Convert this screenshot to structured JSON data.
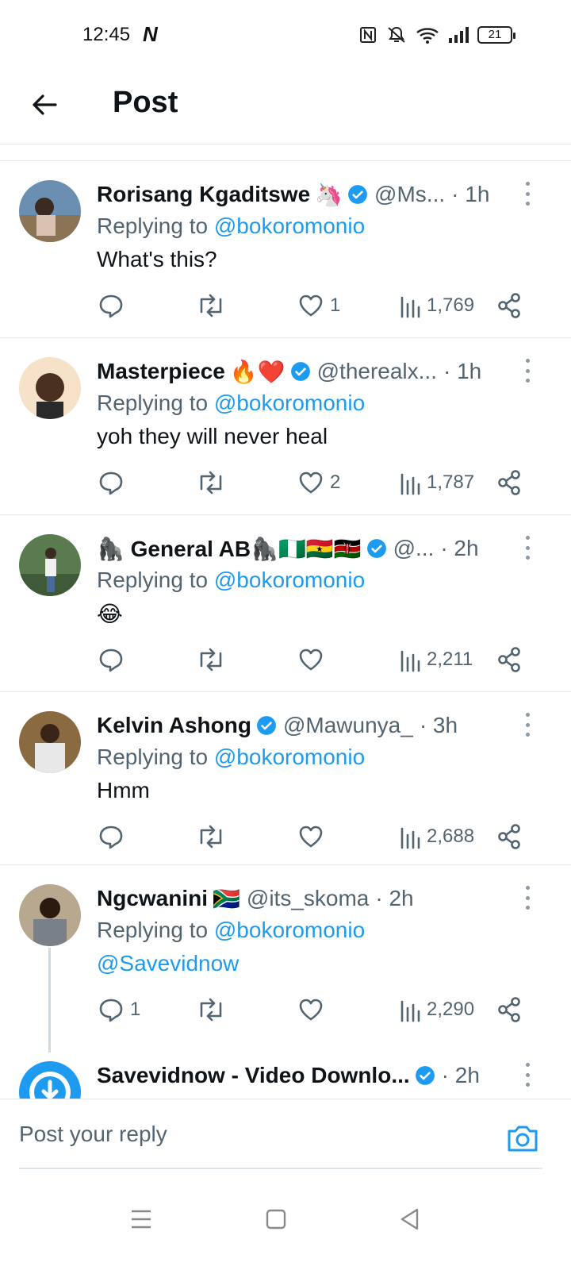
{
  "status_bar": {
    "time": "12:45",
    "notif_letter": "N",
    "battery": "21"
  },
  "header": {
    "title": "Post"
  },
  "tweets": [
    {
      "name": "Rorisang Kgaditswe",
      "emojis": "🦄",
      "verified": true,
      "handle": "@Ms...",
      "time": "· 1h",
      "replying_prefix": "Replying to ",
      "replying_handle": "@bokoromonio",
      "text": "What's this?",
      "text_is_link": false,
      "reply_count": "",
      "retweet_count": "",
      "like_count": "1",
      "views": "1,769"
    },
    {
      "name": "Masterpiece",
      "emojis": "🔥❤️",
      "verified": true,
      "handle": "@therealx...",
      "time": "· 1h",
      "replying_prefix": "Replying to ",
      "replying_handle": "@bokoromonio",
      "text": "yoh they will never heal",
      "text_is_link": false,
      "reply_count": "",
      "retweet_count": "",
      "like_count": "2",
      "views": "1,787"
    },
    {
      "name": "🦍 General AB🦍🇳🇬🇬🇭🇰🇪",
      "emojis": "",
      "verified": true,
      "handle": "@...",
      "time": "· 2h",
      "replying_prefix": "Replying to ",
      "replying_handle": "@bokoromonio",
      "text": "😂",
      "text_is_link": false,
      "reply_count": "",
      "retweet_count": "",
      "like_count": "",
      "views": "2,211"
    },
    {
      "name": "Kelvin Ashong",
      "emojis": "",
      "verified": true,
      "handle": "@Mawunya_",
      "time": "· 3h",
      "replying_prefix": "Replying to ",
      "replying_handle": "@bokoromonio",
      "text": "Hmm",
      "text_is_link": false,
      "reply_count": "",
      "retweet_count": "",
      "like_count": "",
      "views": "2,688"
    },
    {
      "name": "Ngcwanini",
      "emojis": "🇿🇦",
      "verified": false,
      "handle": "@its_skoma",
      "time": "· 2h",
      "replying_prefix": "Replying to ",
      "replying_handle": "@bokoromonio",
      "text": "@Savevidnow",
      "text_is_link": true,
      "reply_count": "1",
      "retweet_count": "",
      "like_count": "",
      "views": "2,290"
    },
    {
      "name": "Savevidnow - Video Downlo...",
      "emojis": "",
      "verified": true,
      "handle": "",
      "time": "· 2h",
      "replying_prefix": "",
      "replying_handle": "",
      "text": "",
      "text_is_link": false,
      "reply_count": "",
      "retweet_count": "",
      "like_count": "",
      "views": ""
    }
  ],
  "reply_bar": {
    "placeholder": "Post your reply"
  },
  "colors": {
    "accent": "#1d9bf0",
    "secondary_text": "#536471",
    "primary_text": "#0f1419"
  }
}
